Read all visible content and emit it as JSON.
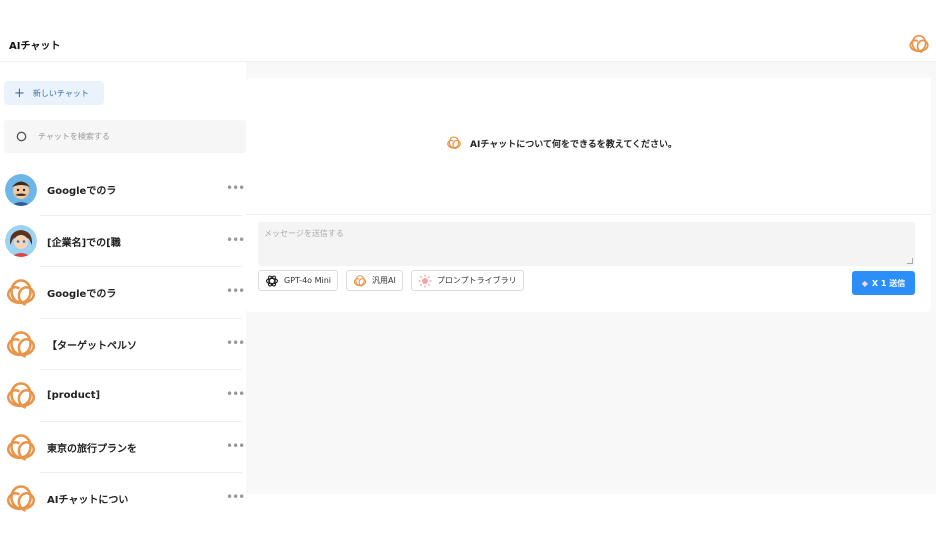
{
  "header": {
    "title": "AIチャット",
    "logo_icon": "knot-logo-icon"
  },
  "sidebar": {
    "new_chat_label": "新しいチャット",
    "search_placeholder": "チャットを検索する",
    "chats": [
      {
        "title": "Googleでのラ",
        "thumb": "avatar-mustache"
      },
      {
        "title": "[企業名]での[職",
        "thumb": "avatar-girl"
      },
      {
        "title": "Googleでのラ",
        "thumb": "knot-logo-icon"
      },
      {
        "title": "【ターゲットペルソ",
        "thumb": "knot-logo-icon"
      },
      {
        "title": "[product]",
        "thumb": "knot-logo-icon"
      },
      {
        "title": "東京の旅行プランを",
        "thumb": "knot-logo-icon"
      },
      {
        "title": "AIチャットについ",
        "thumb": "knot-logo-icon"
      }
    ],
    "more_label": "•••"
  },
  "main": {
    "suggestion_text": "AIチャットについて何をできるを教えてください。",
    "message_placeholder": "メッセージを送信する",
    "tools": [
      {
        "label": "GPT-4o Mini",
        "icon": "openai-icon"
      },
      {
        "label": "汎用AI",
        "icon": "knot-logo-icon"
      },
      {
        "label": "プロンプトライブラリ",
        "icon": "sun-icon"
      }
    ],
    "send_label": "X 1 送信",
    "send_icon": "gem-icon"
  },
  "colors": {
    "accent": "#2c8ef8",
    "logo_orange": "#e8954a",
    "new_chat_bg": "#eaf3fc"
  }
}
